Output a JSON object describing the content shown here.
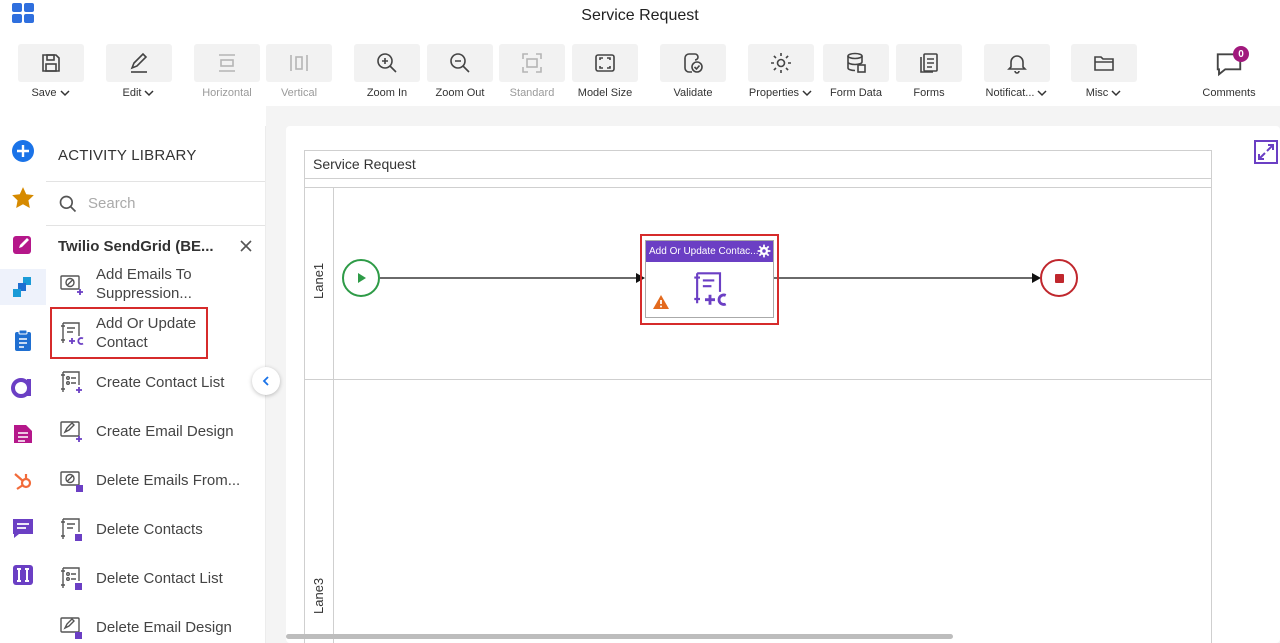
{
  "app": {
    "title": "Service Request"
  },
  "toolbar": {
    "save": "Save",
    "edit": "Edit",
    "horizontal": "Horizontal",
    "vertical": "Vertical",
    "zoom_in": "Zoom In",
    "zoom_out": "Zoom Out",
    "standard": "Standard",
    "model_size": "Model Size",
    "validate": "Validate",
    "properties": "Properties",
    "form_data": "Form Data",
    "forms": "Forms",
    "notifications": "Notificat...",
    "misc": "Misc",
    "comments": "Comments",
    "comments_count": "0"
  },
  "library": {
    "heading": "ACTIVITY LIBRARY",
    "search_placeholder": "Search",
    "group": "Twilio SendGrid (BE...",
    "items": [
      {
        "label": "Add Emails To Suppression...",
        "icon": "suppression-add-icon"
      },
      {
        "label": "Add Or Update Contact",
        "icon": "contact-add-icon"
      },
      {
        "label": "Create Contact List",
        "icon": "contact-list-add-icon"
      },
      {
        "label": "Create Email Design",
        "icon": "email-design-add-icon"
      },
      {
        "label": "Delete Emails From...",
        "icon": "suppression-delete-icon"
      },
      {
        "label": "Delete Contacts",
        "icon": "contact-delete-icon"
      },
      {
        "label": "Delete Contact List",
        "icon": "contact-list-delete-icon"
      },
      {
        "label": "Delete Email Design",
        "icon": "email-design-delete-icon"
      }
    ]
  },
  "diagram": {
    "pool_title": "Service Request",
    "lanes": [
      "Lane1",
      "Lane3"
    ],
    "task_title": "Add Or Update Contac..."
  },
  "colors": {
    "accent": "#2f6fde",
    "purple": "#6b3fc4",
    "highlight": "#d62b2b",
    "start": "#2e9b47",
    "end": "#c0272d"
  }
}
